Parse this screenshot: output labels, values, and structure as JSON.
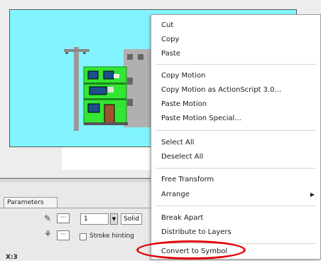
{
  "context_menu": {
    "items": [
      {
        "label": "Cut"
      },
      {
        "label": "Copy"
      },
      {
        "label": "Paste"
      },
      {
        "label": "Copy Motion"
      },
      {
        "label": "Copy Motion as ActionScript 3.0..."
      },
      {
        "label": "Paste Motion"
      },
      {
        "label": "Paste Motion Special..."
      },
      {
        "label": "Select All"
      },
      {
        "label": "Deselect All"
      },
      {
        "label": "Free Transform"
      },
      {
        "label": "Arrange"
      },
      {
        "label": "Break Apart"
      },
      {
        "label": "Distribute to Layers"
      },
      {
        "label": "Convert to Symbol"
      }
    ],
    "highlighted": "Convert to Symbol"
  },
  "properties_panel": {
    "tab_label": "Parameters",
    "stroke_width": "1",
    "stroke_style": "Solid",
    "stroke_hinting_label": "Stroke hinting",
    "bottom_label": "X:3"
  },
  "colors": {
    "canvas": "#82f4ff",
    "highlight": "#e00000",
    "building_green": "#33e633"
  }
}
